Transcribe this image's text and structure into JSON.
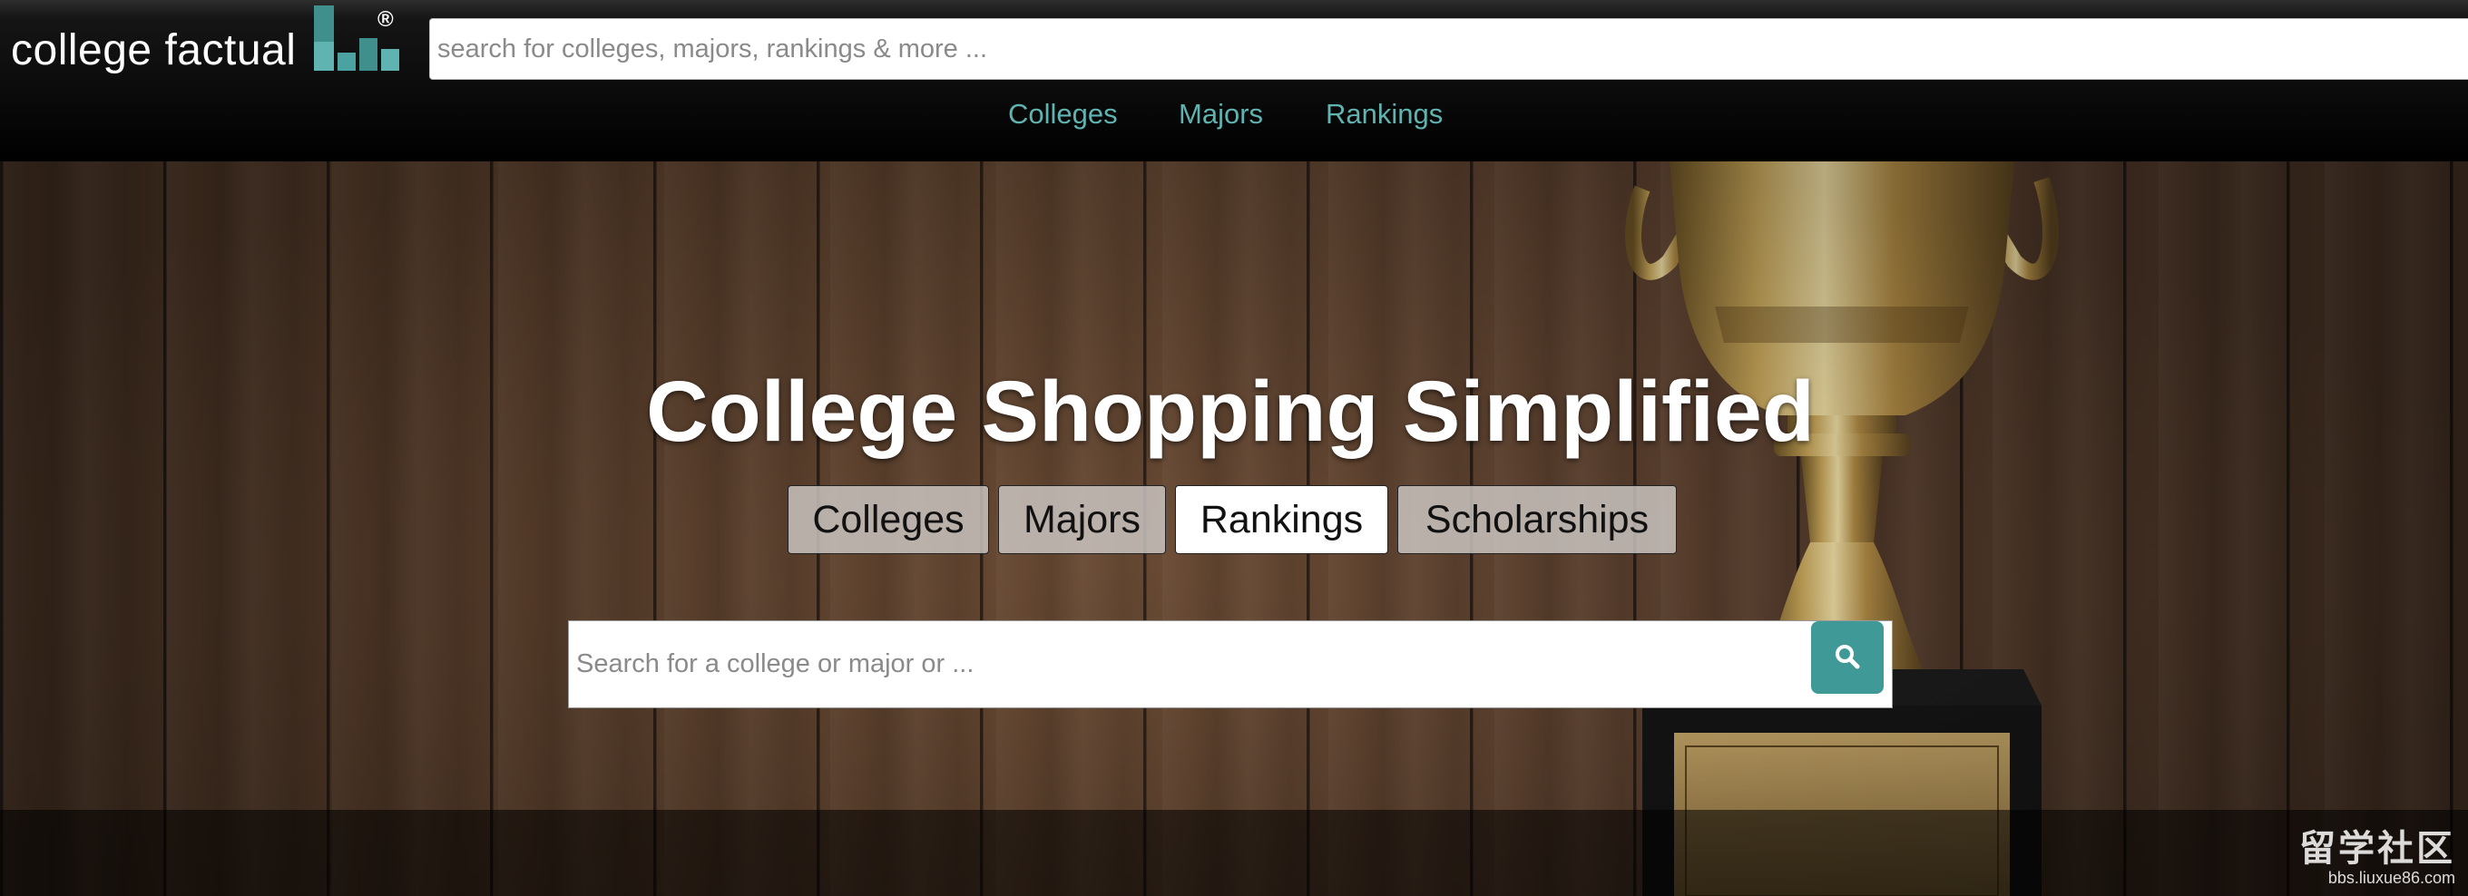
{
  "header": {
    "logo_text_light": "college ",
    "logo_text_bold": "factual",
    "logo_registered": "®",
    "search_placeholder": "search for colleges, majors, rankings & more ..."
  },
  "nav": {
    "items": [
      {
        "label": "Colleges"
      },
      {
        "label": "Majors"
      },
      {
        "label": "Rankings"
      }
    ],
    "link_color": "#5fb3b0"
  },
  "hero": {
    "title": "College Shopping Simplified",
    "tabs": [
      {
        "label": "Colleges",
        "active": false
      },
      {
        "label": "Majors",
        "active": false
      },
      {
        "label": "Rankings",
        "active": true
      },
      {
        "label": "Scholarships",
        "active": false
      }
    ],
    "search_placeholder": "Search for a college or major or ...",
    "search_button_icon": "search-icon",
    "accent": "#3f9a97"
  },
  "watermark": {
    "main": "留学社区",
    "sub": "bbs.liuxue86.com"
  }
}
